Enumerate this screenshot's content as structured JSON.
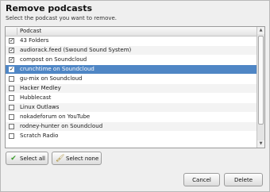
{
  "dialog": {
    "title": "Remove podcasts",
    "subtitle": "Select the podcast you want to remove."
  },
  "list": {
    "column_header": "Podcast",
    "items": [
      {
        "label": "43 Folders",
        "checked": true,
        "selected": false
      },
      {
        "label": "audiorack.feed (Swound Sound System)",
        "checked": true,
        "selected": false
      },
      {
        "label": "compost on Soundcloud",
        "checked": true,
        "selected": false
      },
      {
        "label": "crunchtime on Soundcloud",
        "checked": true,
        "selected": true
      },
      {
        "label": "gu-mix on Soundcloud",
        "checked": false,
        "selected": false
      },
      {
        "label": "Hacker Medley",
        "checked": false,
        "selected": false
      },
      {
        "label": "Hubblecast",
        "checked": false,
        "selected": false
      },
      {
        "label": "Linux Outlaws",
        "checked": false,
        "selected": false
      },
      {
        "label": "nokadeforum on YouTube",
        "checked": false,
        "selected": false
      },
      {
        "label": "rodney-hunter on Soundcloud",
        "checked": false,
        "selected": false
      },
      {
        "label": "Scratch Radio",
        "checked": false,
        "selected": false
      }
    ]
  },
  "buttons": {
    "select_all": "Select all",
    "select_none": "Select none",
    "cancel": "Cancel",
    "delete": "Delete"
  },
  "icons": {
    "select_all": "checkmark-icon",
    "select_none": "paint-brush-icon",
    "checkbox_checked": "checkmark-icon"
  },
  "colors": {
    "selection": "#4f86c5",
    "dialog_background": "#efefef",
    "select_all_icon": "#3a9a2a"
  }
}
